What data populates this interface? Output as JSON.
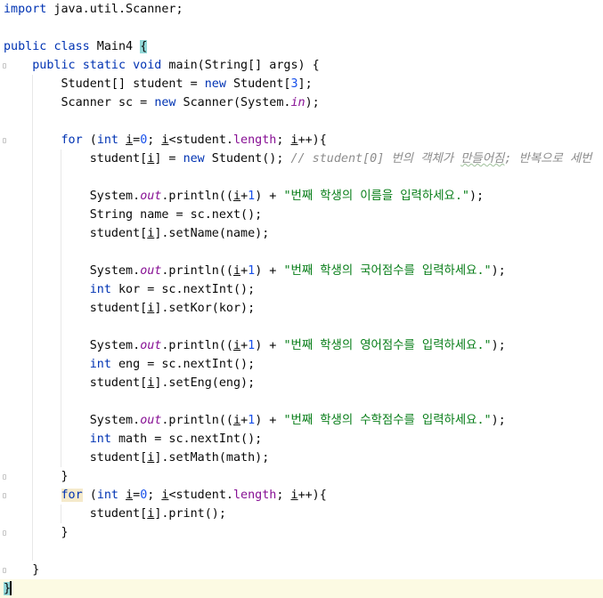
{
  "editor": {
    "lines": [
      "import java.util.Scanner;",
      "",
      "public class Main4 {",
      "    public static void main(String[] args) {",
      "        Student[] student = new Student[3];",
      "        Scanner sc = new Scanner(System.in);",
      "",
      "        for (int i=0; i<student.length; i++){",
      "            student[i] = new Student(); // student[0] 번의 객체가 만들어짐; 반복으로 세번",
      "",
      "            System.out.println((i+1) + \"번째 학생의 이름을 입력하세요.\");",
      "            String name = sc.next();",
      "            student[i].setName(name);",
      "",
      "            System.out.println((i+1) + \"번째 학생의 국어점수를 입력하세요.\");",
      "            int kor = sc.nextInt();",
      "            student[i].setKor(kor);",
      "",
      "            System.out.println((i+1) + \"번째 학생의 영어점수를 입력하세요.\");",
      "            int eng = sc.nextInt();",
      "            student[i].setEng(eng);",
      "",
      "            System.out.println((i+1) + \"번째 학생의 수학점수를 입력하세요.\");",
      "            int math = sc.nextInt();",
      "            student[i].setMath(math);",
      "        }",
      "        for (int i=0; i<student.length; i++){",
      "            student[i].print();",
      "        }",
      "",
      "    }",
      "}"
    ],
    "caret_line": 32,
    "colors": {
      "keyword": "#0033b3",
      "number": "#1750eb",
      "string": "#067d17",
      "comment": "#8c8c8c",
      "field": "#871094",
      "brace_match": "#93d9d9",
      "caret_line": "#fcfae3"
    }
  }
}
